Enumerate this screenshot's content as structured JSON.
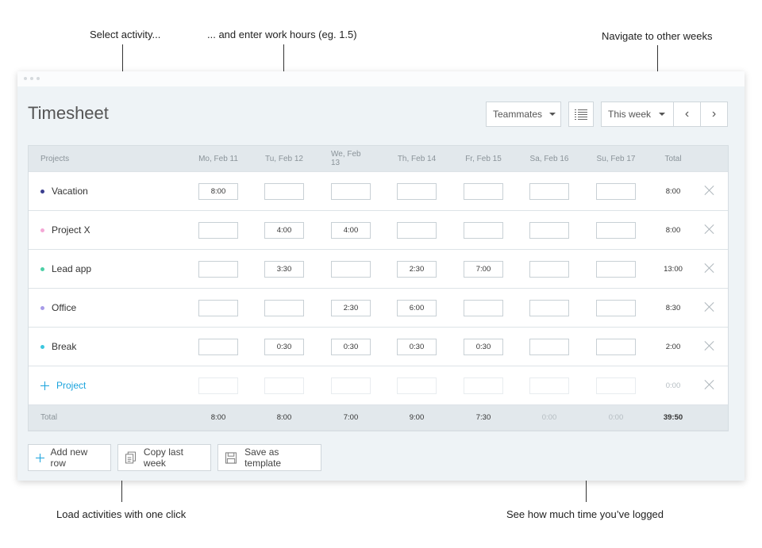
{
  "callouts": {
    "select_activity": "Select activity...",
    "enter_hours": "... and enter work hours (eg. 1.5)",
    "navigate_weeks": "Navigate to other weeks",
    "load_activities": "Load activities with one click",
    "time_logged": "See how much time you’ve logged"
  },
  "page": {
    "title": "Timesheet"
  },
  "controls": {
    "teammates": "Teammates",
    "week": "This week",
    "prev": "‹",
    "next": "›"
  },
  "table": {
    "columns": [
      "Projects",
      "Mo, Feb 11",
      "Tu, Feb 12",
      "We, Feb 13",
      "Th, Feb 14",
      "Fr, Feb 15",
      "Sa, Feb 16",
      "Su, Feb 17",
      "Total"
    ],
    "rows": [
      {
        "name": "Vacation",
        "color": "#3b3f8f",
        "hours": [
          "8:00",
          "",
          "",
          "",
          "",
          "",
          ""
        ],
        "total": "8:00"
      },
      {
        "name": "Project X",
        "color": "#f4a8d6",
        "hours": [
          "",
          "4:00",
          "4:00",
          "",
          "",
          "",
          ""
        ],
        "total": "8:00"
      },
      {
        "name": "Lead app",
        "color": "#4ccfa6",
        "hours": [
          "",
          "3:30",
          "",
          "2:30",
          "7:00",
          "",
          ""
        ],
        "total": "13:00"
      },
      {
        "name": "Office",
        "color": "#a79be8",
        "hours": [
          "",
          "",
          "2:30",
          "6:00",
          "",
          "",
          ""
        ],
        "total": "8:30"
      },
      {
        "name": "Break",
        "color": "#3cc7de",
        "hours": [
          "",
          "0:30",
          "0:30",
          "0:30",
          "0:30",
          "",
          ""
        ],
        "total": "2:00"
      }
    ],
    "new_row": {
      "label": "Project",
      "total": "0:00"
    },
    "footer": {
      "label": "Total",
      "days": [
        "8:00",
        "8:00",
        "7:00",
        "9:00",
        "7:30",
        "0:00",
        "0:00"
      ],
      "grand_total": "39:50"
    }
  },
  "actions": {
    "add_row": "Add new row",
    "copy_last_week": "Copy last week",
    "save_template": "Save as template"
  },
  "colors": {
    "accent": "#1aa3dd",
    "header_bg": "#e2e8ec",
    "window_bg": "#eef3f6"
  }
}
